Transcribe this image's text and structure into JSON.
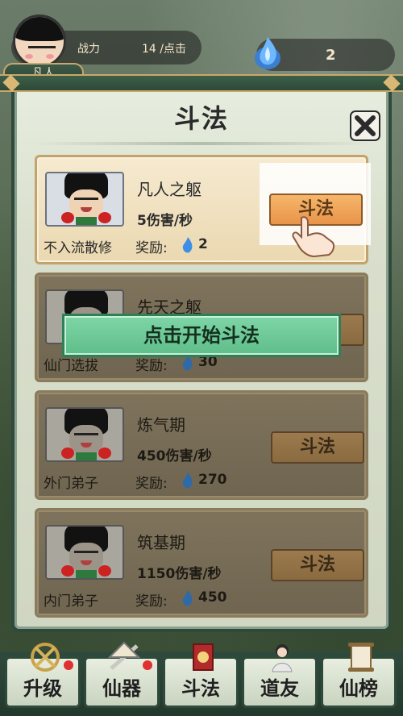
{
  "hud": {
    "power_label": "战力",
    "power_value": "14 /点击",
    "rank_label": "凡人",
    "currency_value": "2"
  },
  "panel": {
    "title": "斗法"
  },
  "cards": [
    {
      "name": "凡人之躯",
      "damage": "5伤害/秒",
      "rank": "不入流散修",
      "reward_label": "奖励:",
      "reward_value": "2",
      "button": "斗法",
      "locked": false
    },
    {
      "name": "先天之躯",
      "damage": "",
      "rank": "仙门选拔",
      "reward_label": "奖励:",
      "reward_value": "30",
      "button": "",
      "locked": true
    },
    {
      "name": "炼气期",
      "damage": "450伤害/秒",
      "rank": "外门弟子",
      "reward_label": "奖励:",
      "reward_value": "270",
      "button": "斗法",
      "locked": true
    },
    {
      "name": "筑基期",
      "damage": "1150伤害/秒",
      "rank": "内门弟子",
      "reward_label": "奖励:",
      "reward_value": "450",
      "button": "斗法",
      "locked": true
    }
  ],
  "toast": "点击开始斗法",
  "tabs": [
    {
      "label": "升级",
      "icon": "upgrade-icon",
      "dot": true
    },
    {
      "label": "仙器",
      "icon": "artifact-icon",
      "dot": true
    },
    {
      "label": "斗法",
      "icon": "battle-icon",
      "dot": false
    },
    {
      "label": "道友",
      "icon": "companion-icon",
      "dot": false
    },
    {
      "label": "仙榜",
      "icon": "ranking-icon",
      "dot": false
    }
  ],
  "colors": {
    "panel_border": "#2f4a3c",
    "accent_gold": "#c9a86a",
    "button_orange": "#f6b66a",
    "toast_green": "#5fbe8a"
  }
}
